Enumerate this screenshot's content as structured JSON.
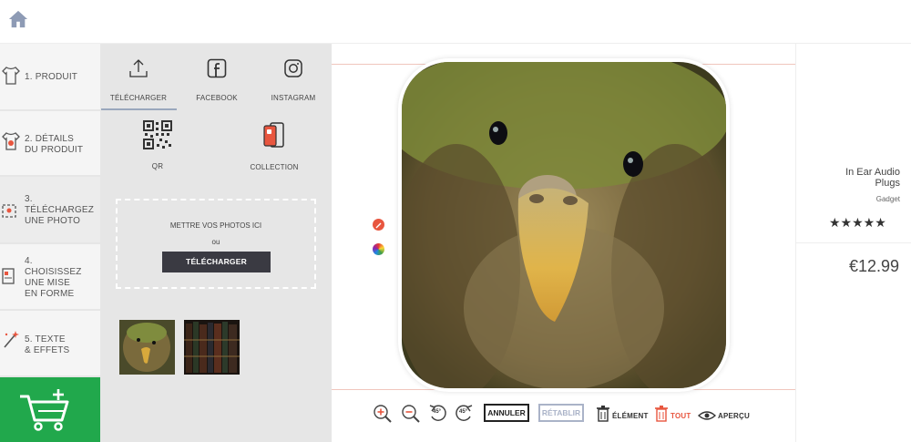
{
  "nav": {
    "home_icon": "home-icon"
  },
  "steps": [
    {
      "label": "1. PRODUIT",
      "icon": "tshirt-icon"
    },
    {
      "label": "2. DÉTAILS\nDU PRODUIT",
      "icon": "tshirt-details-icon"
    },
    {
      "label": "3.\nTÉLÉCHARGEZ\nUNE PHOTO",
      "icon": "upload-photo-icon"
    },
    {
      "label": "4.\nCHOISISSEZ\nUNE MISE\nEN FORME",
      "icon": "layout-icon"
    },
    {
      "label": "5. TEXTE\n& EFFETS",
      "icon": "magic-wand-icon"
    }
  ],
  "cart": {
    "icon": "add-to-cart-icon",
    "color": "#21a84c"
  },
  "sources": [
    {
      "label": "TÉLÉCHARGER",
      "icon": "upload-icon"
    },
    {
      "label": "FACEBOOK",
      "icon": "facebook-icon"
    },
    {
      "label": "INSTAGRAM",
      "icon": "instagram-icon"
    },
    {
      "label": "QR",
      "icon": "qr-code-icon"
    },
    {
      "label": "COLLECTION",
      "icon": "phone-collection-icon"
    }
  ],
  "dropzone": {
    "text": "METTRE VOS PHOTOS ICI",
    "or": "ou",
    "button": "TÉLÉCHARGER"
  },
  "toolbar": {
    "zoom_in": "zoom-in-icon",
    "zoom_out": "zoom-out-icon",
    "rotate_left": "45°",
    "rotate_right": "45°",
    "undo": "ANNULER",
    "redo": "RÉTABLIR",
    "delete_element": "ÉLÉMENT",
    "delete_all": "TOUT",
    "preview": "APERÇU"
  },
  "product": {
    "title": "In Ear Audio\nPlugs",
    "category": "Gadget",
    "stars": "★★★★★",
    "rating": 5,
    "price": "€12.99"
  },
  "colors": {
    "accent_red": "#e8563f",
    "guide": "#f0c6bd",
    "panel": "#e6e6e6"
  }
}
